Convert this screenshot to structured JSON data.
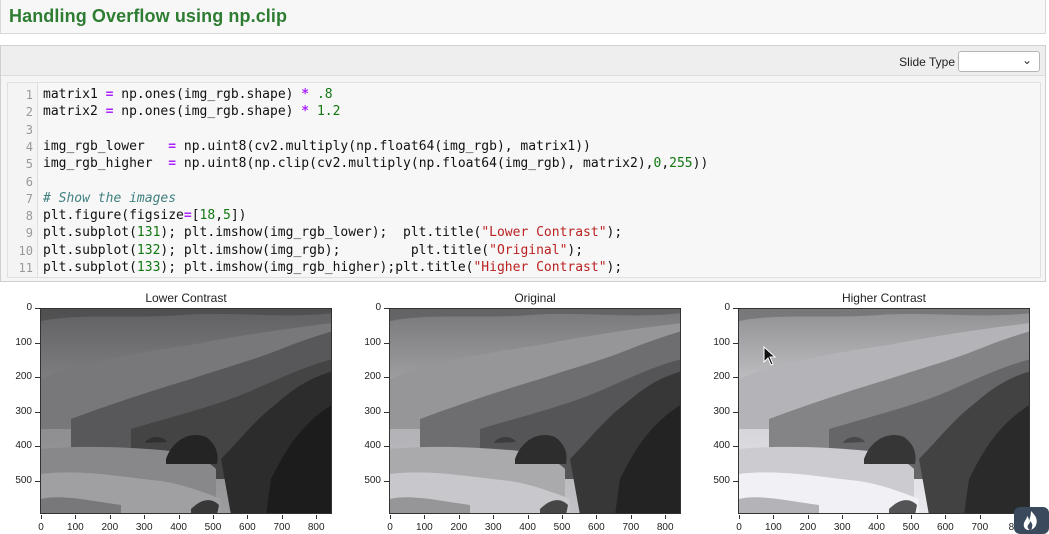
{
  "markdown": {
    "heading": "Handling Overflow using np.clip"
  },
  "toolbar": {
    "slide_type_label": "Slide Type",
    "slide_type_value": ""
  },
  "code_lines": [
    {
      "n": "1",
      "text": "matrix1 = np.ones(img_rgb.shape) * .8"
    },
    {
      "n": "2",
      "text": "matrix2 = np.ones(img_rgb.shape) * 1.2"
    },
    {
      "n": "3",
      "text": ""
    },
    {
      "n": "4",
      "text": "img_rgb_lower   = np.uint8(cv2.multiply(np.float64(img_rgb), matrix1))"
    },
    {
      "n": "5",
      "text": "img_rgb_higher  = np.uint8(np.clip(cv2.multiply(np.float64(img_rgb), matrix2),0,255))"
    },
    {
      "n": "6",
      "text": ""
    },
    {
      "n": "7",
      "text": "# Show the images"
    },
    {
      "n": "8",
      "text": "plt.figure(figsize=[18,5])"
    },
    {
      "n": "9",
      "text": "plt.subplot(131); plt.imshow(img_rgb_lower);  plt.title(\"Lower Contrast\");"
    },
    {
      "n": "10",
      "text": "plt.subplot(132); plt.imshow(img_rgb);         plt.title(\"Original\");"
    },
    {
      "n": "11",
      "text": "plt.subplot(133); plt.imshow(img_rgb_higher);plt.title(\"Higher Contrast\");"
    }
  ],
  "plots": [
    {
      "title": "Lower Contrast",
      "brightness": 0.8,
      "x_ticks_shown": [
        "0",
        "100",
        "200",
        "300",
        "400",
        "500",
        "600",
        "700",
        "800"
      ]
    },
    {
      "title": "Original",
      "brightness": 1.0,
      "x_ticks_shown": [
        "0",
        "100",
        "200",
        "300",
        "400",
        "500",
        "600",
        "700",
        "800"
      ]
    },
    {
      "title": "Higher Contrast",
      "brightness": 1.2,
      "x_ticks_shown": [
        "0",
        "100",
        "200",
        "300",
        "400",
        "500",
        "600",
        "700",
        "80"
      ]
    }
  ],
  "y_ticks": [
    "0",
    "100",
    "200",
    "300",
    "400",
    "500"
  ],
  "icons": {
    "cursor": "mouse-pointer-icon",
    "logo": "flame-logo-icon"
  }
}
